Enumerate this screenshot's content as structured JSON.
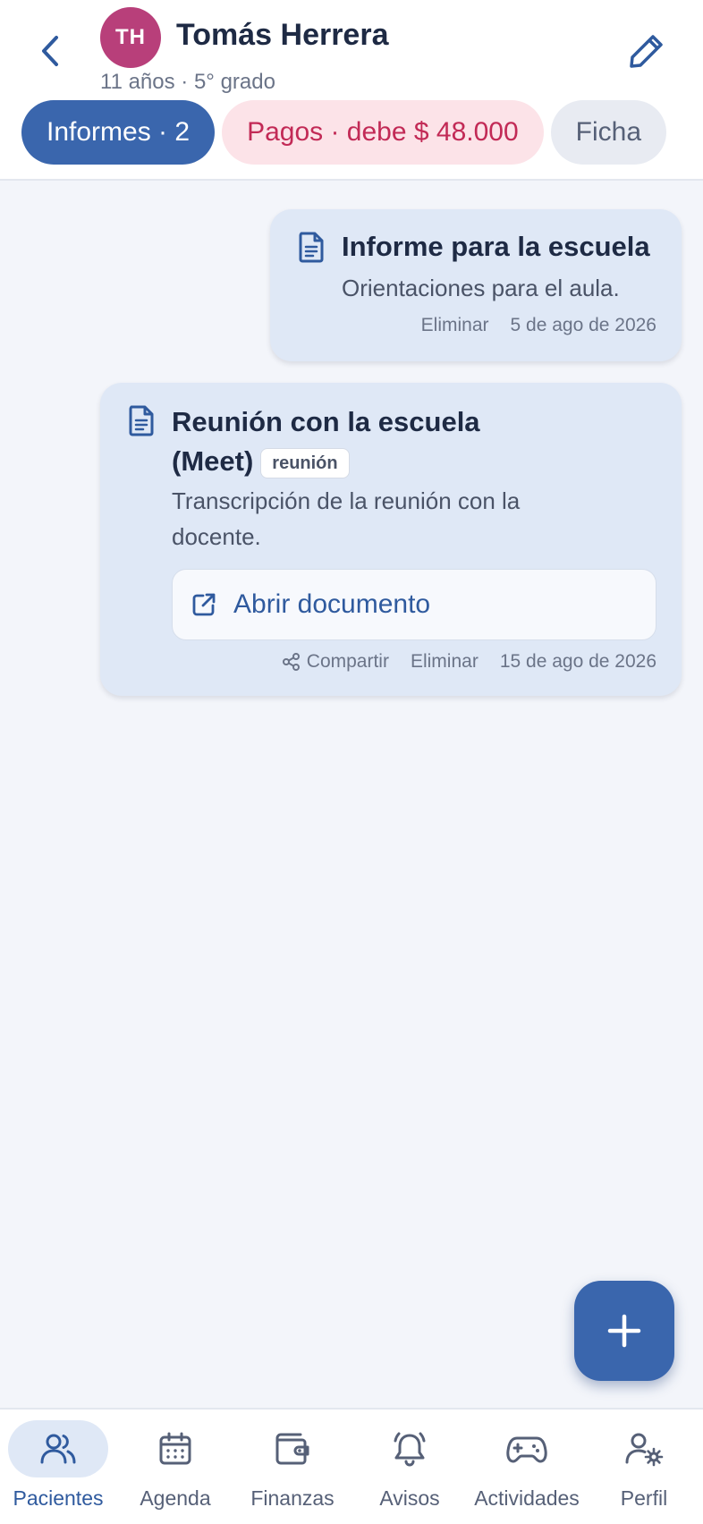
{
  "header": {
    "avatar_initials": "TH",
    "name": "Tomás Herrera",
    "subtitle": "11 años · 5° grado"
  },
  "tabs": [
    {
      "label": "Informes · 2",
      "state": "active"
    },
    {
      "label": "Pagos · debe $ 48.000",
      "state": "debt"
    },
    {
      "label": "Ficha",
      "state": "default"
    }
  ],
  "reports": [
    {
      "title": "Informe para la escuela",
      "description": "Orientaciones para el aula.",
      "delete_label": "Eliminar",
      "date": "5 de ago de 2026"
    },
    {
      "title_line1": "Reunión con la escuela",
      "title_line2": "(Meet)",
      "tag": "reunión",
      "description": "Transcripción de la reunión con la docente.",
      "open_label": "Abrir documento",
      "share_label": "Compartir",
      "delete_label": "Eliminar",
      "date": "15 de ago de 2026"
    }
  ],
  "bottom_nav": [
    {
      "label": "Pacientes",
      "icon": "users-icon"
    },
    {
      "label": "Agenda",
      "icon": "calendar-icon"
    },
    {
      "label": "Finanzas",
      "icon": "wallet-icon"
    },
    {
      "label": "Avisos",
      "icon": "bell-icon"
    },
    {
      "label": "Actividades",
      "icon": "gamepad-icon"
    },
    {
      "label": "Perfil",
      "icon": "user-settings-icon"
    }
  ],
  "colors": {
    "primary": "#3a66ad",
    "avatar": "#b83f7a",
    "debt_text": "#c22a56",
    "debt_bg": "#fce3e8",
    "card_bg": "#dfe8f6"
  }
}
